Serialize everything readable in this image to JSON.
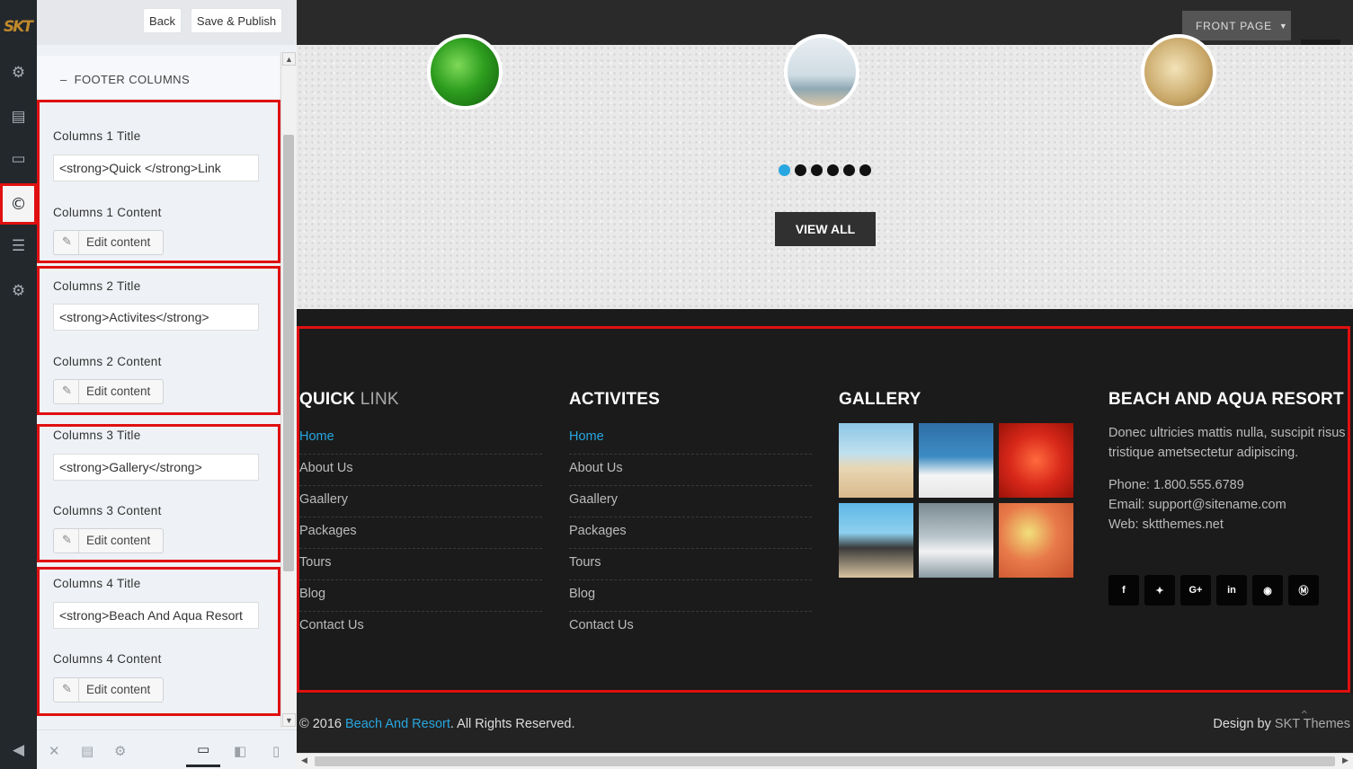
{
  "colors": {
    "accent_blue": "#27a6e0",
    "highlight_red": "#e01010",
    "rail_bg": "#23282d",
    "footer_bg": "#1b1b1b"
  },
  "rail": {
    "logo": "SKT",
    "icons": [
      "gear-icon",
      "card-icon",
      "monitor-icon",
      "copyright-icon",
      "list-icon",
      "gear-icon"
    ]
  },
  "toolbar": {
    "back_label": "Back",
    "save_label": "Save & Publish"
  },
  "section": {
    "title": "FOOTER COLUMNS"
  },
  "columns": [
    {
      "title_label": "Columns 1 Title",
      "title_value": "<strong>Quick </strong>Link",
      "content_label": "Columns 1 Content",
      "edit_label": "Edit content"
    },
    {
      "title_label": "Columns 2 Title",
      "title_value": "<strong>Activites</strong>",
      "content_label": "Columns 2 Content",
      "edit_label": "Edit content"
    },
    {
      "title_label": "Columns 3 Title",
      "title_value": "<strong>Gallery</strong>",
      "content_label": "Columns 3 Content",
      "edit_label": "Edit content"
    },
    {
      "title_label": "Columns 4 Title",
      "title_value": "<strong>Beach And Aqua Resort",
      "content_label": "Columns 4 Content",
      "edit_label": "Edit content"
    }
  ],
  "preview": {
    "front_page_label": "FRONT PAGE",
    "slider_active_dot": 1,
    "slider_dot_count": 6,
    "view_all_label": "VIEW ALL",
    "footer": {
      "col1": {
        "title_bold": "QUICK",
        "title_thin": " LINK",
        "links": [
          "Home",
          "About Us",
          "Gaallery",
          "Packages",
          "Tours",
          "Blog",
          "Contact Us"
        ]
      },
      "col2": {
        "title": "ACTIVITES",
        "links": [
          "Home",
          "About Us",
          "Gaallery",
          "Packages",
          "Tours",
          "Blog",
          "Contact Us"
        ]
      },
      "col3": {
        "title": "GALLERY",
        "image_count": 6
      },
      "col4": {
        "title": "BEACH AND AQUA RESORT",
        "about_line1": "Donec ultricies mattis nulla, suscipit risus",
        "about_line2": "tristique ametsectetur adipiscing.",
        "phone": "Phone: 1.800.555.6789",
        "email_label": "Email: ",
        "email": "support@sitename.com",
        "web": "Web: sktthemes.net",
        "social_icons": [
          "facebook-icon",
          "twitter-icon",
          "google-plus-icon",
          "linkedin-icon",
          "pinterest-icon",
          "skype-icon"
        ]
      }
    },
    "copyright": {
      "prefix": "© 2016 ",
      "site": "Beach And Resort",
      "suffix": ". All Rights Reserved.",
      "design_by": "Design by ",
      "designer": "SKT Themes"
    }
  }
}
